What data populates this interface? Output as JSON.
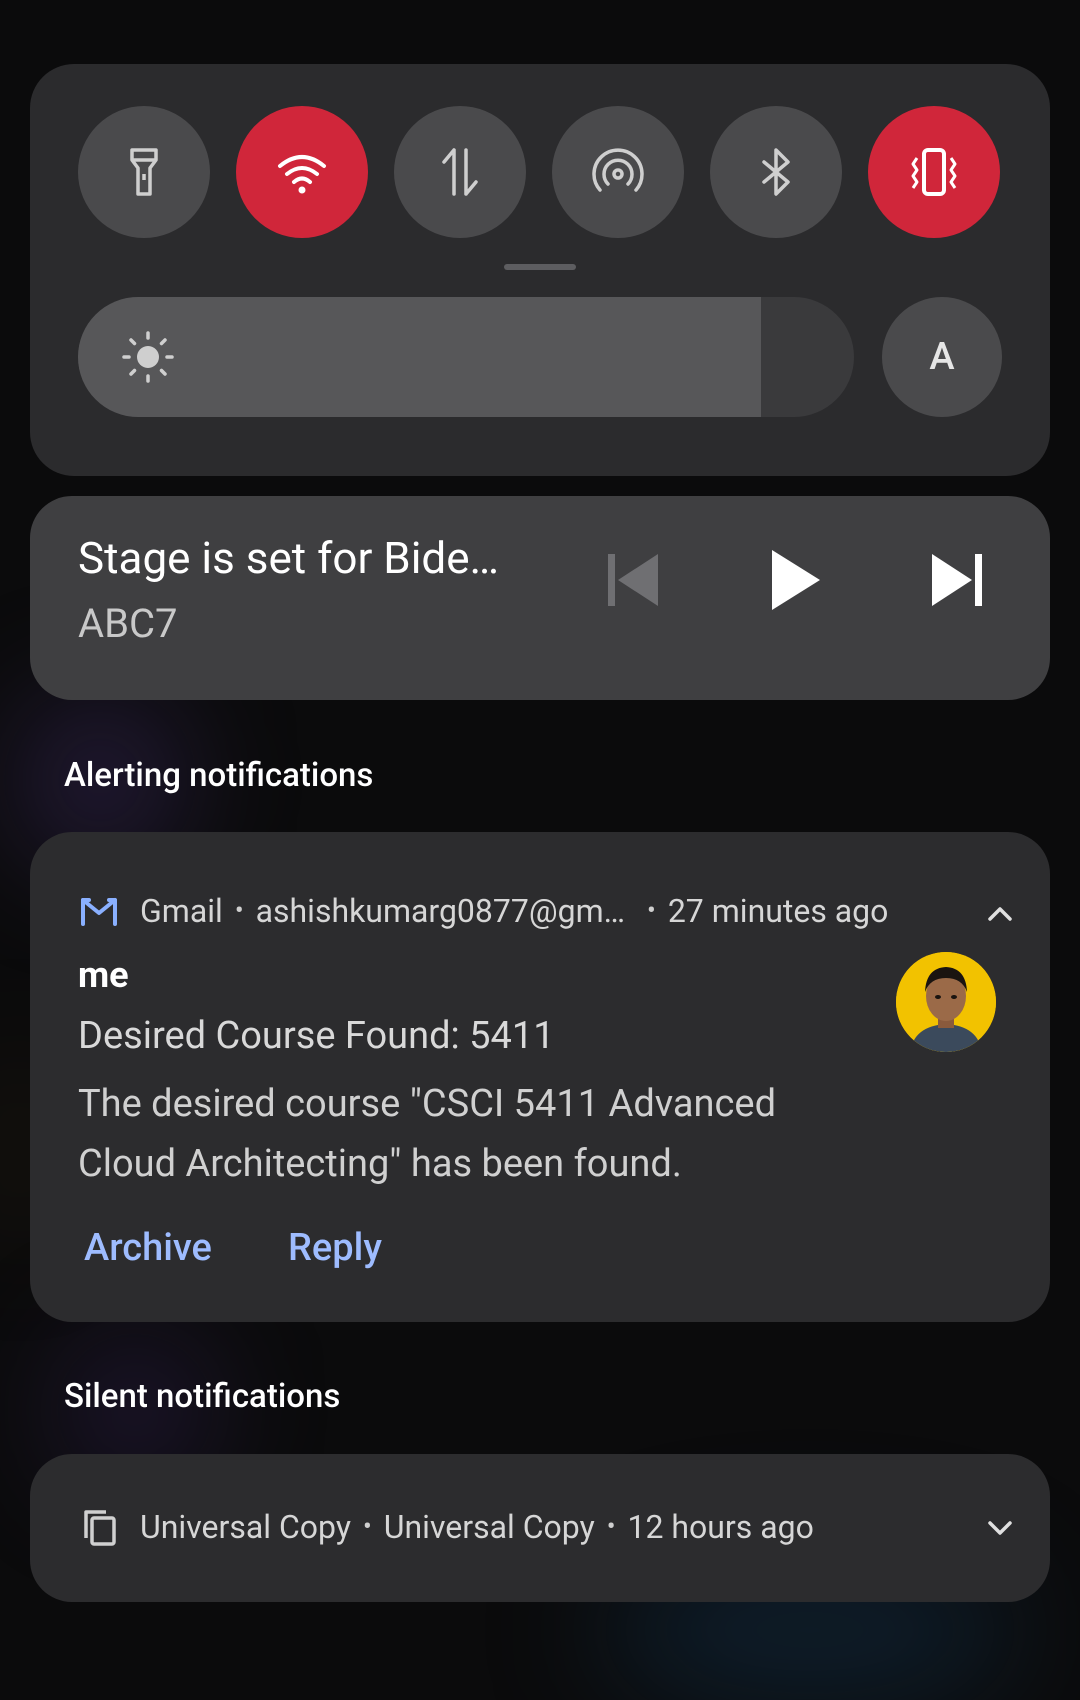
{
  "quick_settings": {
    "tiles": [
      {
        "name": "flashlight",
        "icon": "flashlight-icon",
        "active": false
      },
      {
        "name": "wifi",
        "icon": "wifi-icon",
        "active": true
      },
      {
        "name": "mobile-data",
        "icon": "mobile-data-icon",
        "active": false
      },
      {
        "name": "hotspot",
        "icon": "hotspot-icon",
        "active": false
      },
      {
        "name": "bluetooth",
        "icon": "bluetooth-icon",
        "active": false
      },
      {
        "name": "vibrate",
        "icon": "vibrate-icon",
        "active": true
      }
    ],
    "brightness_level": 0.88,
    "auto_label": "A",
    "accent_color": "#d0263a"
  },
  "media": {
    "title": "Stage is set for Bide…",
    "source": "ABC7"
  },
  "sections": {
    "alerting": "Alerting notifications",
    "silent": "Silent notifications"
  },
  "gmail": {
    "app": "Gmail",
    "account": "ashishkumarg0877@gm…",
    "time": "27 minutes ago",
    "sender": "me",
    "subject": "Desired Course Found: 5411",
    "body": "The desired course \"CSCI 5411 Advanced Cloud Architecting\" has been found.",
    "actions": {
      "archive": "Archive",
      "reply": "Reply"
    }
  },
  "universal_copy": {
    "app": "Universal Copy",
    "title": "Universal Copy",
    "time": "12 hours ago"
  }
}
